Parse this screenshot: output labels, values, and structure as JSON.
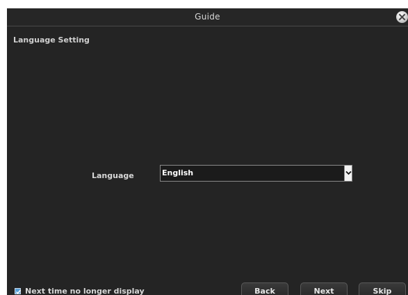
{
  "dialog": {
    "title": "Guide",
    "section_title": "Language Setting"
  },
  "language": {
    "label": "Language",
    "selected": "English"
  },
  "footer": {
    "checkbox_label": "Next time no longer display",
    "checkbox_checked": true,
    "back_label": "Back",
    "next_label": "Next",
    "skip_label": "Skip"
  },
  "icons": {
    "close": "close-icon",
    "dropdown": "chevron-down-icon",
    "check": "check-icon"
  },
  "colors": {
    "background": "#242424",
    "checkbox": "#5aa0d8"
  }
}
